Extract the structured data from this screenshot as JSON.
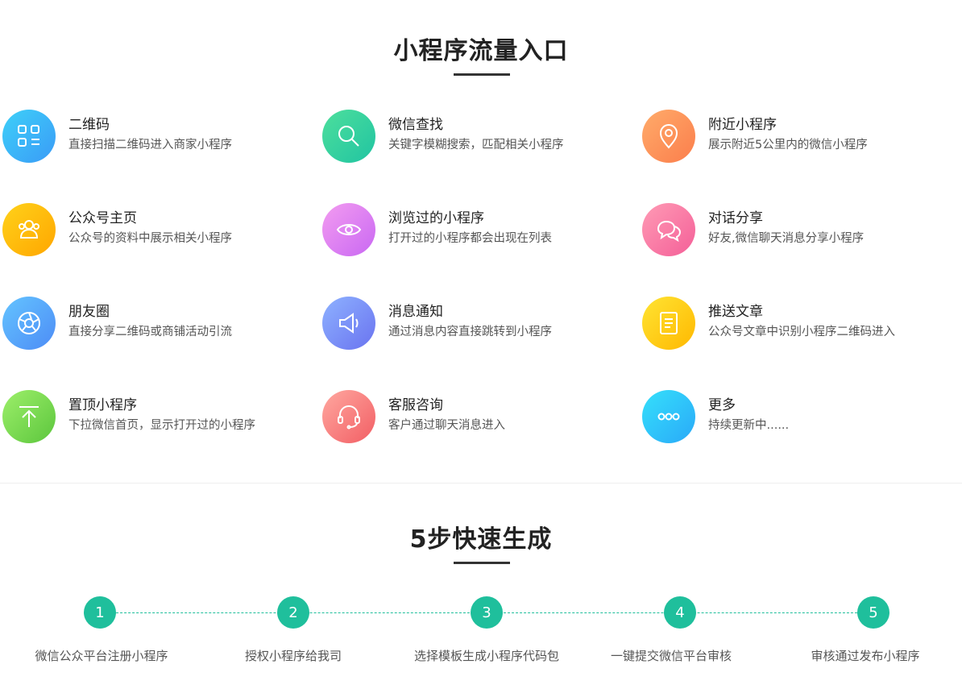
{
  "section1": {
    "title": "小程序流量入口"
  },
  "entries": [
    {
      "title": "二维码",
      "desc": "直接扫描二维码进入商家小程序",
      "icon": "qrcode-icon",
      "color_from": "#3ed0f8",
      "color_to": "#3a9bf7"
    },
    {
      "title": "微信查找",
      "desc": "关键字模糊搜索，匹配相关小程序",
      "icon": "search-icon",
      "color_from": "#4ddf9c",
      "color_to": "#21c4a2"
    },
    {
      "title": "附近小程序",
      "desc": "展示附近5公里内的微信小程序",
      "icon": "location-pin-icon",
      "color_from": "#ffab6a",
      "color_to": "#fb7e4c"
    },
    {
      "title": "公众号主页",
      "desc": "公众号的资料中展示相关小程序",
      "icon": "users-icon",
      "color_from": "#ffd21a",
      "color_to": "#ffa600"
    },
    {
      "title": "浏览过的小程序",
      "desc": "打开过的小程序都会出现在列表",
      "icon": "eye-icon",
      "color_from": "#f39cf0",
      "color_to": "#c968f3"
    },
    {
      "title": "对话分享",
      "desc": "好友,微信聊天消息分享小程序",
      "icon": "chat-bubbles-icon",
      "color_from": "#ff9bb5",
      "color_to": "#f45f98"
    },
    {
      "title": "朋友圈",
      "desc": "直接分享二维码或商铺活动引流",
      "icon": "aperture-icon",
      "color_from": "#64c4ff",
      "color_to": "#4d8cf6"
    },
    {
      "title": "消息通知",
      "desc": "通过消息内容直接跳转到小程序",
      "icon": "speaker-icon",
      "color_from": "#8eb2ff",
      "color_to": "#6a73f0"
    },
    {
      "title": "推送文章",
      "desc": "公众号文章中识别小程序二维码进入",
      "icon": "article-icon",
      "color_from": "#ffe433",
      "color_to": "#ffb800"
    },
    {
      "title": "置顶小程序",
      "desc": "下拉微信首页，显示打开过的小程序",
      "icon": "arrow-top-icon",
      "color_from": "#9def6a",
      "color_to": "#5cc63d"
    },
    {
      "title": "客服咨询",
      "desc": "客户通过聊天消息进入",
      "icon": "headset-icon",
      "color_from": "#ffa8a0",
      "color_to": "#f25e64"
    },
    {
      "title": "更多",
      "desc": "持续更新中......",
      "icon": "more-dots-icon",
      "color_from": "#35e0fb",
      "color_to": "#2aa9f8"
    }
  ],
  "section2": {
    "title": "5步快速生成"
  },
  "steps": [
    {
      "number": "1",
      "label": "微信公众平台注册小程序"
    },
    {
      "number": "2",
      "label": "授权小程序给我司"
    },
    {
      "number": "3",
      "label": "选择模板生成小程序代码包"
    },
    {
      "number": "4",
      "label": "一键提交微信平台审核"
    },
    {
      "number": "5",
      "label": "审核通过发布小程序"
    }
  ],
  "colors": {
    "accent": "#1fbf9c",
    "title": "#222222"
  }
}
